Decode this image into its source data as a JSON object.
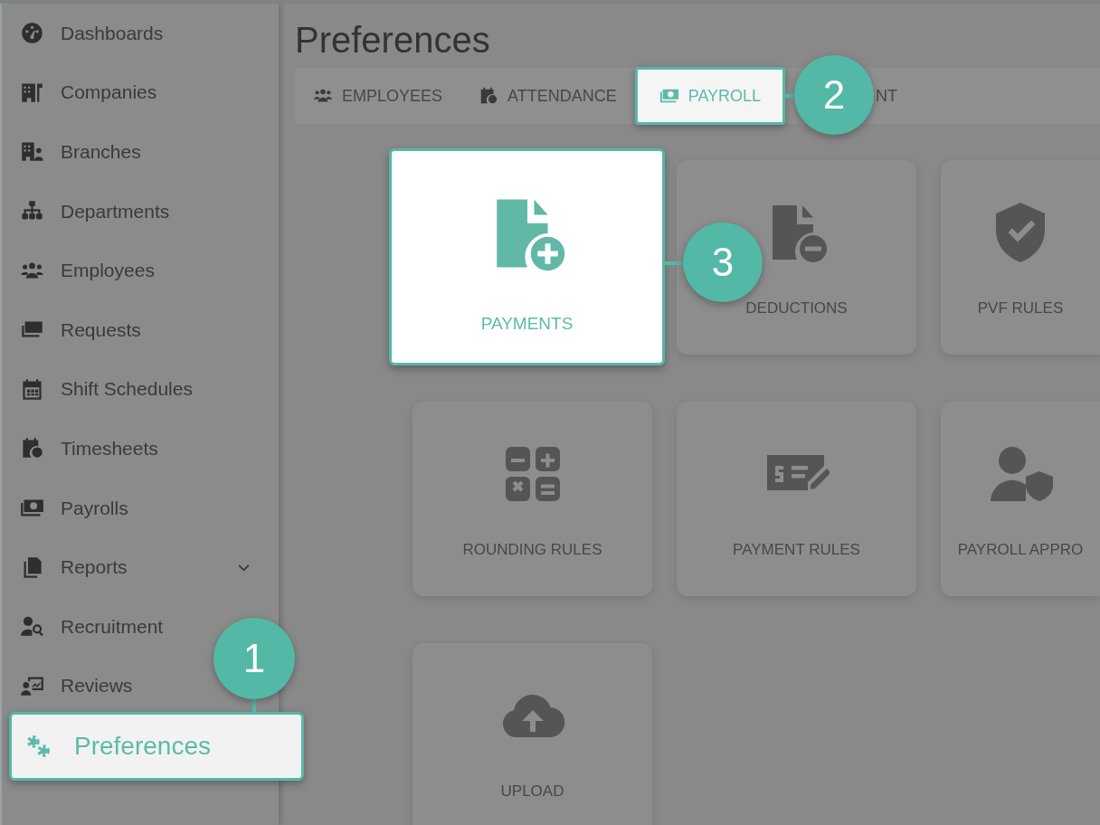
{
  "sidebar": {
    "items": [
      {
        "label": "Dashboards",
        "selected": false,
        "expandable": false
      },
      {
        "label": "Companies",
        "selected": false,
        "expandable": false
      },
      {
        "label": "Branches",
        "selected": false,
        "expandable": false
      },
      {
        "label": "Departments",
        "selected": false,
        "expandable": false
      },
      {
        "label": "Employees",
        "selected": false,
        "expandable": false
      },
      {
        "label": "Requests",
        "selected": false,
        "expandable": false
      },
      {
        "label": "Shift Schedules",
        "selected": false,
        "expandable": false
      },
      {
        "label": "Timesheets",
        "selected": false,
        "expandable": false
      },
      {
        "label": "Payrolls",
        "selected": false,
        "expandable": false
      },
      {
        "label": "Reports",
        "selected": false,
        "expandable": true
      },
      {
        "label": "Recruitment",
        "selected": false,
        "expandable": false
      },
      {
        "label": "Reviews",
        "selected": false,
        "expandable": false
      },
      {
        "label": "Preferences",
        "selected": true,
        "expandable": false,
        "callout": "1"
      }
    ]
  },
  "page": {
    "title": "Preferences"
  },
  "tabs": [
    {
      "label": "EMPLOYEES",
      "selected": false
    },
    {
      "label": "ATTENDANCE",
      "selected": false
    },
    {
      "label": "PAYROLL",
      "selected": true,
      "callout": "2"
    },
    {
      "label": "NT",
      "selected": false
    }
  ],
  "cards": [
    {
      "label": "PAYMENTS",
      "selected": true,
      "callout": "3"
    },
    {
      "label": "DEDUCTIONS",
      "selected": false
    },
    {
      "label": "PVF RULES",
      "selected": false
    },
    {
      "label": "ROUNDING RULES",
      "selected": false
    },
    {
      "label": "PAYMENT RULES",
      "selected": false
    },
    {
      "label": "PAYROLL APPRO",
      "selected": false
    },
    {
      "label": "UPLOAD",
      "selected": false
    }
  ]
}
